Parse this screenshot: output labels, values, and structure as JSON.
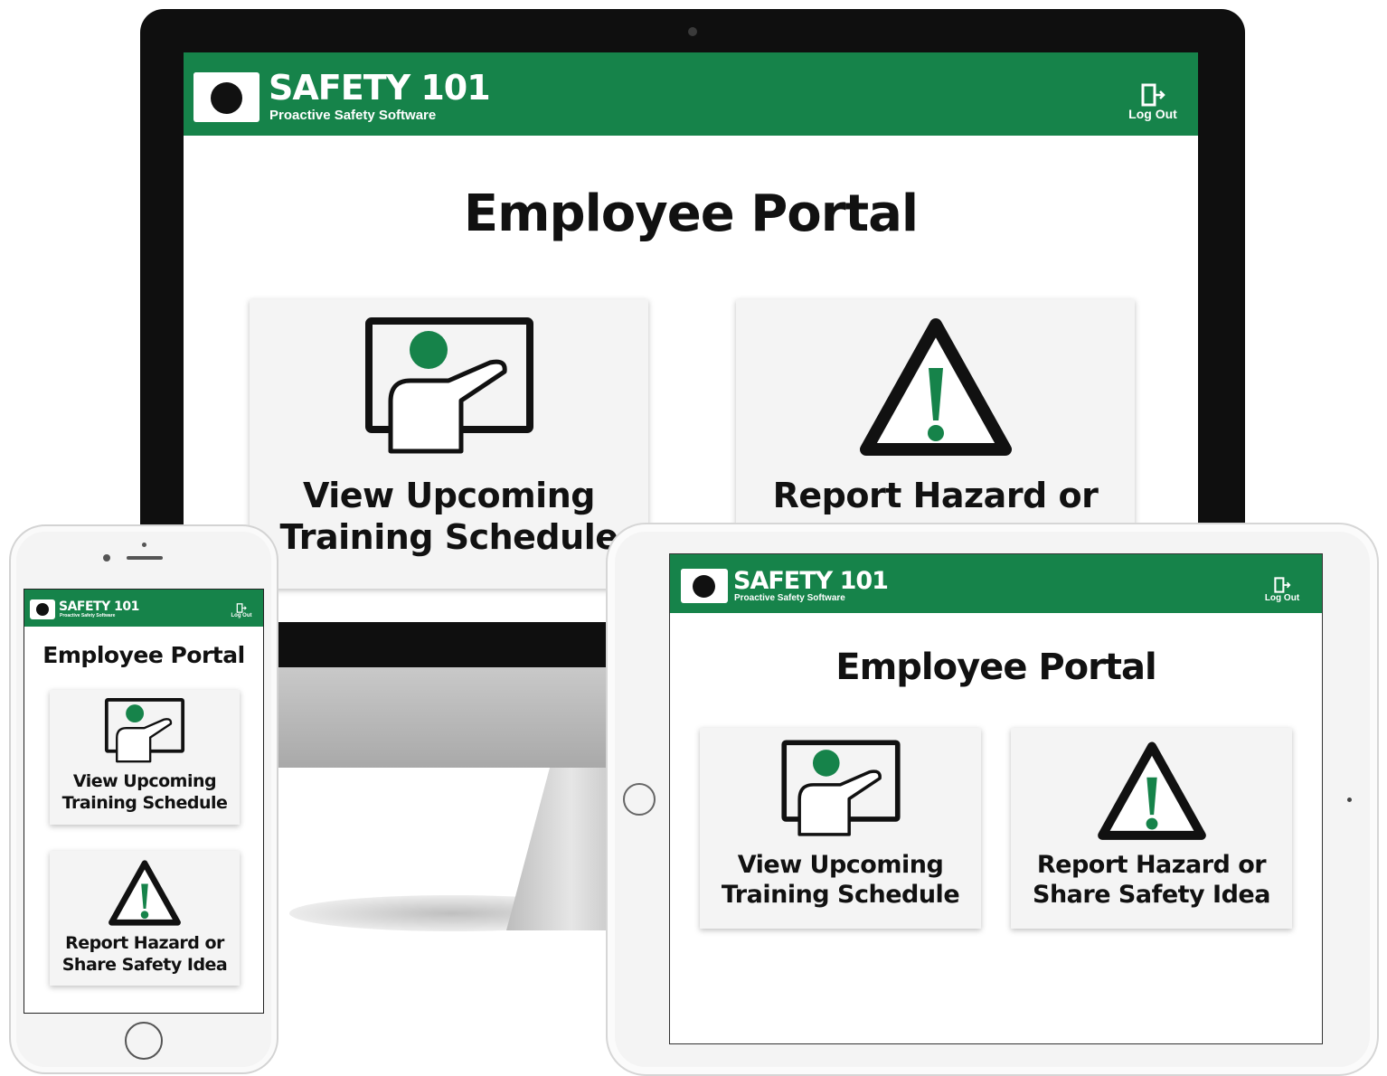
{
  "brand": {
    "name": "SAFETY 101",
    "tagline": "Proactive Safety Software",
    "color": "#16834a"
  },
  "header": {
    "logout_label": "Log Out",
    "logout_icon": "door-exit-icon",
    "logo_icon": "first-aid-kit-icon"
  },
  "page": {
    "title": "Employee Portal"
  },
  "cards": {
    "training": {
      "line1": "View Upcoming",
      "line2": "Training Schedule",
      "icon": "teacher-whiteboard-icon"
    },
    "hazard": {
      "line1": "Report Hazard or",
      "line2": "Share Safety Idea",
      "icon": "warning-triangle-icon"
    }
  }
}
